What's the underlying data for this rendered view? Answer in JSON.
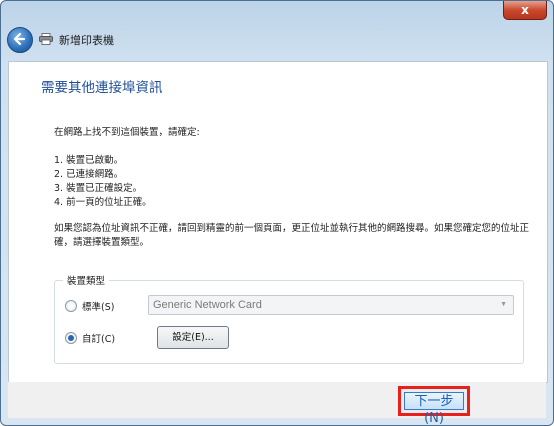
{
  "window": {
    "close_glyph": "x",
    "title": "新增印表機"
  },
  "page": {
    "heading": "需要其他連接埠資訊",
    "intro": "在網路上找不到這個裝置，請確定:",
    "checklist": [
      "1. 裝置已啟動。",
      "2. 已連接網路。",
      "3. 裝置已正確設定。",
      "4. 前一頁的位址正確。"
    ],
    "advice": "如果您認為位址資訊不正確，請回到精靈的前一個頁面，更正位址並執行其他的網路搜尋。如果您確定您的位址正確，請選擇裝置類型。"
  },
  "device_type": {
    "legend": "裝置類型",
    "standard_label": "標準(S)",
    "standard_selected": false,
    "standard_value": "Generic Network Card",
    "custom_label": "自訂(C)",
    "custom_selected": true,
    "settings_button": "設定(E)..."
  },
  "footer": {
    "next_button": "下一步(N)"
  },
  "icons": {
    "back": "back-arrow-icon",
    "printer": "printer-icon",
    "close": "close-icon",
    "dropdown": "chevron-down-icon"
  }
}
